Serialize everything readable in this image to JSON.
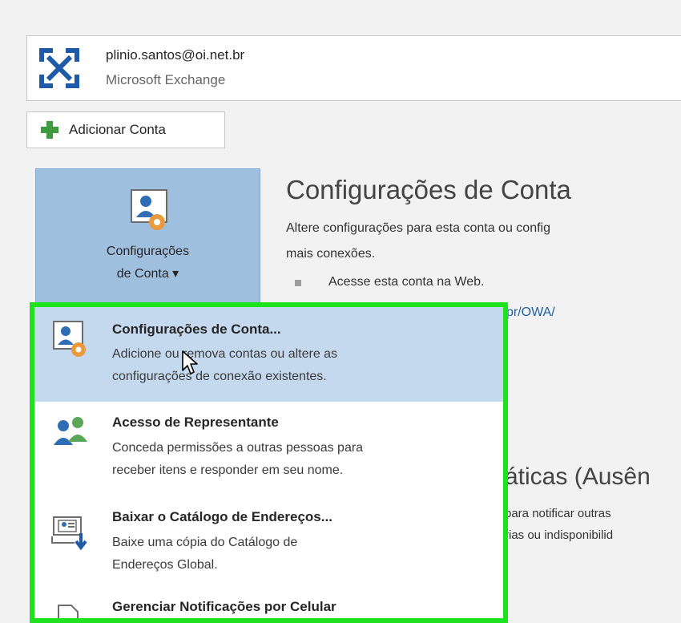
{
  "account": {
    "email": "plinio.santos@oi.net.br",
    "type": "Microsoft Exchange",
    "icon": "exchange-icon"
  },
  "add_account": {
    "label": "Adicionar Conta",
    "icon": "plus-icon"
  },
  "config_button": {
    "line1": "Configurações",
    "line2": "de Conta ▾",
    "icon": "account-settings-icon"
  },
  "section": {
    "title": "Configurações de Conta",
    "desc_line1": "Altere configurações para esta conta ou config",
    "desc_line2": "mais conexões.",
    "bullet": "Acesse esta conta na Web.",
    "link": "pr/OWA/"
  },
  "auto_reply": {
    "title": "áticas (Ausên",
    "desc_line1": "para notificar outras",
    "desc_line2": "rias ou indisponibilid"
  },
  "menu": {
    "items": [
      {
        "title": "Configurações de Conta...",
        "desc_line1": "Adicione ou remova contas ou altere as",
        "desc_line2": "configurações de conexão existentes.",
        "icon": "account-settings-icon"
      },
      {
        "title": "Acesso de Representante",
        "desc_line1": "Conceda permissões a outras pessoas para",
        "desc_line2": "receber itens e responder em seu nome.",
        "icon": "delegate-people-icon"
      },
      {
        "title": "Baixar o Catálogo de Endereços...",
        "desc_line1": "Baixe uma cópia do Catálogo de",
        "desc_line2": "Endereços Global.",
        "icon": "download-address-book-icon"
      },
      {
        "title": "Gerenciar Notificações por Celular",
        "icon": "mobile-notifications-icon"
      }
    ]
  },
  "colors": {
    "highlight_border": "#1ee21e",
    "selected_bg": "#c4d9ee",
    "big_button_bg": "#9fbfdf",
    "link": "#1c5fa0"
  }
}
